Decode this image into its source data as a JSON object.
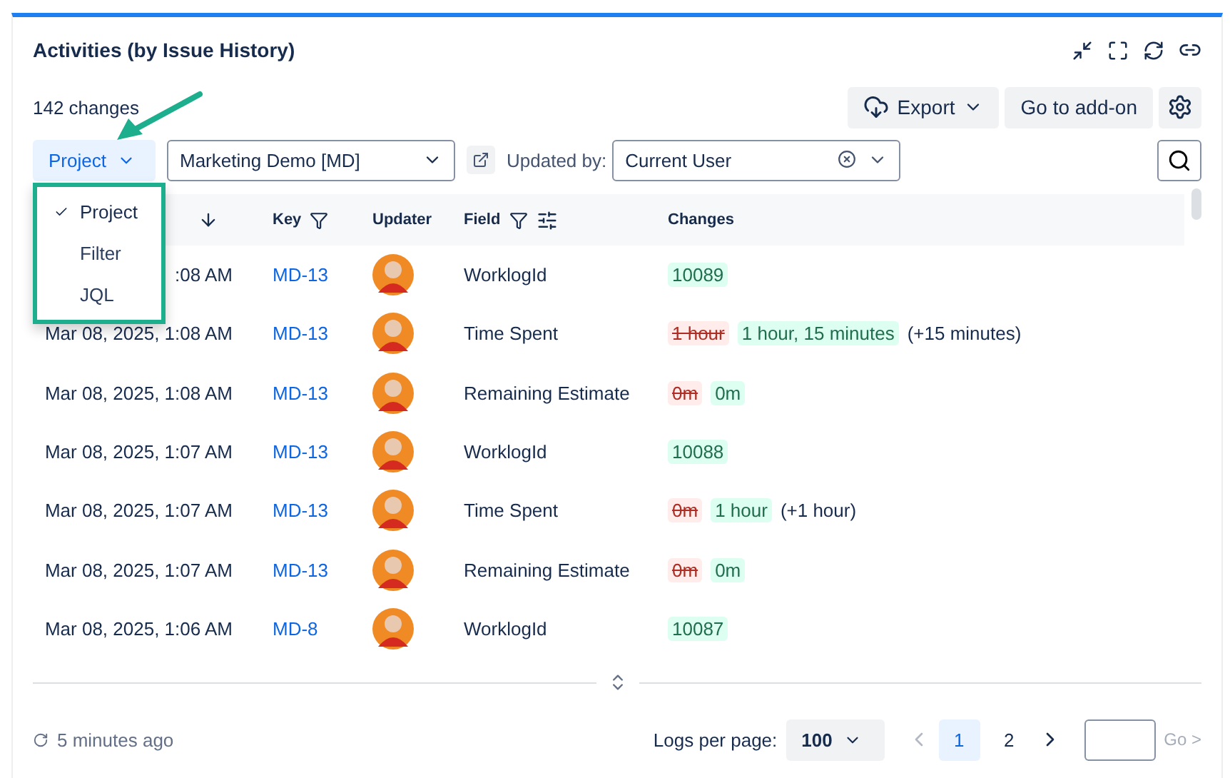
{
  "panel": {
    "title": "Activities (by Issue History)",
    "count": "142 changes"
  },
  "toolbar": {
    "export": "Export",
    "addon": "Go to add-on"
  },
  "filters": {
    "scope": "Project",
    "scope_menu": [
      {
        "label": "Project",
        "selected": true
      },
      {
        "label": "Filter",
        "selected": false
      },
      {
        "label": "JQL",
        "selected": false
      }
    ],
    "project": "Marketing Demo [MD]",
    "updated_by_label": "Updated by:",
    "updated_by": "Current User"
  },
  "table": {
    "columns": [
      {
        "label": "Key",
        "kind": "filter"
      },
      {
        "label": "Updater",
        "kind": "plain"
      },
      {
        "label": "Field",
        "kind": "filter_settings"
      },
      {
        "label": "Changes",
        "kind": "plain"
      }
    ],
    "rows": [
      {
        "date": ":08 AM",
        "key": "MD-13",
        "field": "WorklogId",
        "changes": [
          {
            "kind": "new",
            "text": "10089"
          }
        ]
      },
      {
        "date": "Mar 08, 2025, 1:08 AM",
        "key": "MD-13",
        "field": "Time Spent",
        "changes": [
          {
            "kind": "old",
            "text": "1 hour"
          },
          {
            "kind": "new",
            "text": "1 hour, 15 minutes"
          },
          {
            "kind": "note",
            "text": "(+15 minutes)"
          }
        ]
      },
      {
        "date": "Mar 08, 2025, 1:08 AM",
        "key": "MD-13",
        "field": "Remaining Estimate",
        "changes": [
          {
            "kind": "old",
            "text": "0m"
          },
          {
            "kind": "new",
            "text": "0m"
          }
        ]
      },
      {
        "date": "Mar 08, 2025, 1:07 AM",
        "key": "MD-13",
        "field": "WorklogId",
        "changes": [
          {
            "kind": "new",
            "text": "10088"
          }
        ]
      },
      {
        "date": "Mar 08, 2025, 1:07 AM",
        "key": "MD-13",
        "field": "Time Spent",
        "changes": [
          {
            "kind": "old",
            "text": "0m"
          },
          {
            "kind": "new",
            "text": "1 hour"
          },
          {
            "kind": "note",
            "text": "(+1 hour)"
          }
        ]
      },
      {
        "date": "Mar 08, 2025, 1:07 AM",
        "key": "MD-13",
        "field": "Remaining Estimate",
        "changes": [
          {
            "kind": "old",
            "text": "0m"
          },
          {
            "kind": "new",
            "text": "0m"
          }
        ]
      },
      {
        "date": "Mar 08, 2025, 1:06 AM",
        "key": "MD-8",
        "field": "WorklogId",
        "changes": [
          {
            "kind": "new",
            "text": "10087"
          }
        ]
      }
    ]
  },
  "footer": {
    "updated": "5 minutes ago",
    "per_page_label": "Logs per page:",
    "per_page": "100",
    "pages": [
      {
        "label": "1",
        "selected": true
      },
      {
        "label": "2",
        "selected": false
      }
    ],
    "go": "Go >"
  }
}
